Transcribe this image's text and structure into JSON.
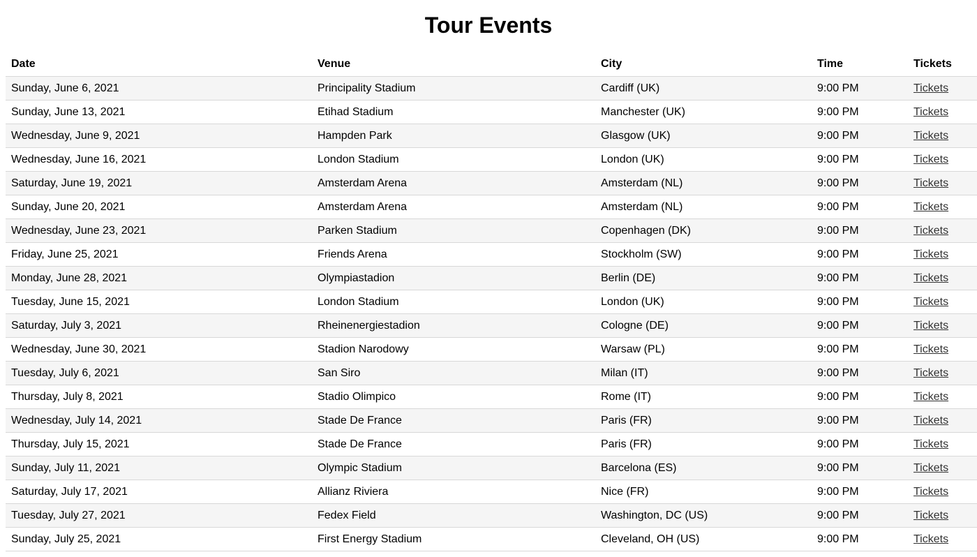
{
  "page": {
    "title": "Tour Events"
  },
  "table": {
    "headers": {
      "date": "Date",
      "venue": "Venue",
      "city": "City",
      "time": "Time",
      "tickets": "Tickets"
    },
    "rows": [
      {
        "date": "Sunday, June 6, 2021",
        "venue": "Principality Stadium",
        "city": "Cardiff (UK)",
        "time": "9:00 PM",
        "tickets": "Tickets"
      },
      {
        "date": "Sunday, June 13, 2021",
        "venue": "Etihad Stadium",
        "city": "Manchester (UK)",
        "time": "9:00 PM",
        "tickets": "Tickets"
      },
      {
        "date": "Wednesday, June 9, 2021",
        "venue": "Hampden Park",
        "city": "Glasgow (UK)",
        "time": "9:00 PM",
        "tickets": "Tickets"
      },
      {
        "date": "Wednesday, June 16, 2021",
        "venue": "London Stadium",
        "city": "London (UK)",
        "time": "9:00 PM",
        "tickets": "Tickets"
      },
      {
        "date": "Saturday, June 19, 2021",
        "venue": "Amsterdam Arena",
        "city": "Amsterdam (NL)",
        "time": "9:00 PM",
        "tickets": "Tickets"
      },
      {
        "date": "Sunday, June 20, 2021",
        "venue": "Amsterdam Arena",
        "city": "Amsterdam (NL)",
        "time": "9:00 PM",
        "tickets": "Tickets"
      },
      {
        "date": "Wednesday, June 23, 2021",
        "venue": "Parken Stadium",
        "city": "Copenhagen (DK)",
        "time": "9:00 PM",
        "tickets": "Tickets"
      },
      {
        "date": "Friday, June 25, 2021",
        "venue": "Friends Arena",
        "city": "Stockholm (SW)",
        "time": "9:00 PM",
        "tickets": "Tickets"
      },
      {
        "date": "Monday, June 28, 2021",
        "venue": "Olympiastadion",
        "city": "Berlin (DE)",
        "time": "9:00 PM",
        "tickets": "Tickets"
      },
      {
        "date": "Tuesday, June 15, 2021",
        "venue": "London Stadium",
        "city": "London (UK)",
        "time": "9:00 PM",
        "tickets": "Tickets"
      },
      {
        "date": "Saturday, July 3, 2021",
        "venue": "Rheinenergiestadion",
        "city": "Cologne (DE)",
        "time": "9:00 PM",
        "tickets": "Tickets"
      },
      {
        "date": "Wednesday, June 30, 2021",
        "venue": "Stadion Narodowy",
        "city": "Warsaw (PL)",
        "time": "9:00 PM",
        "tickets": "Tickets"
      },
      {
        "date": "Tuesday, July 6, 2021",
        "venue": "San Siro",
        "city": "Milan (IT)",
        "time": "9:00 PM",
        "tickets": "Tickets"
      },
      {
        "date": "Thursday, July 8, 2021",
        "venue": "Stadio Olimpico",
        "city": "Rome (IT)",
        "time": "9:00 PM",
        "tickets": "Tickets"
      },
      {
        "date": "Wednesday, July 14, 2021",
        "venue": "Stade De France",
        "city": "Paris (FR)",
        "time": "9:00 PM",
        "tickets": "Tickets"
      },
      {
        "date": "Thursday, July 15, 2021",
        "venue": "Stade De France",
        "city": "Paris (FR)",
        "time": "9:00 PM",
        "tickets": "Tickets"
      },
      {
        "date": "Sunday, July 11, 2021",
        "venue": "Olympic Stadium",
        "city": "Barcelona (ES)",
        "time": "9:00 PM",
        "tickets": "Tickets"
      },
      {
        "date": "Saturday, July 17, 2021",
        "venue": "Allianz Riviera",
        "city": "Nice (FR)",
        "time": "9:00 PM",
        "tickets": "Tickets"
      },
      {
        "date": "Tuesday, July 27, 2021",
        "venue": "Fedex Field",
        "city": "Washington, DC (US)",
        "time": "9:00 PM",
        "tickets": "Tickets"
      },
      {
        "date": "Sunday, July 25, 2021",
        "venue": "First Energy Stadium",
        "city": "Cleveland, OH (US)",
        "time": "9:00 PM",
        "tickets": "Tickets"
      }
    ]
  }
}
